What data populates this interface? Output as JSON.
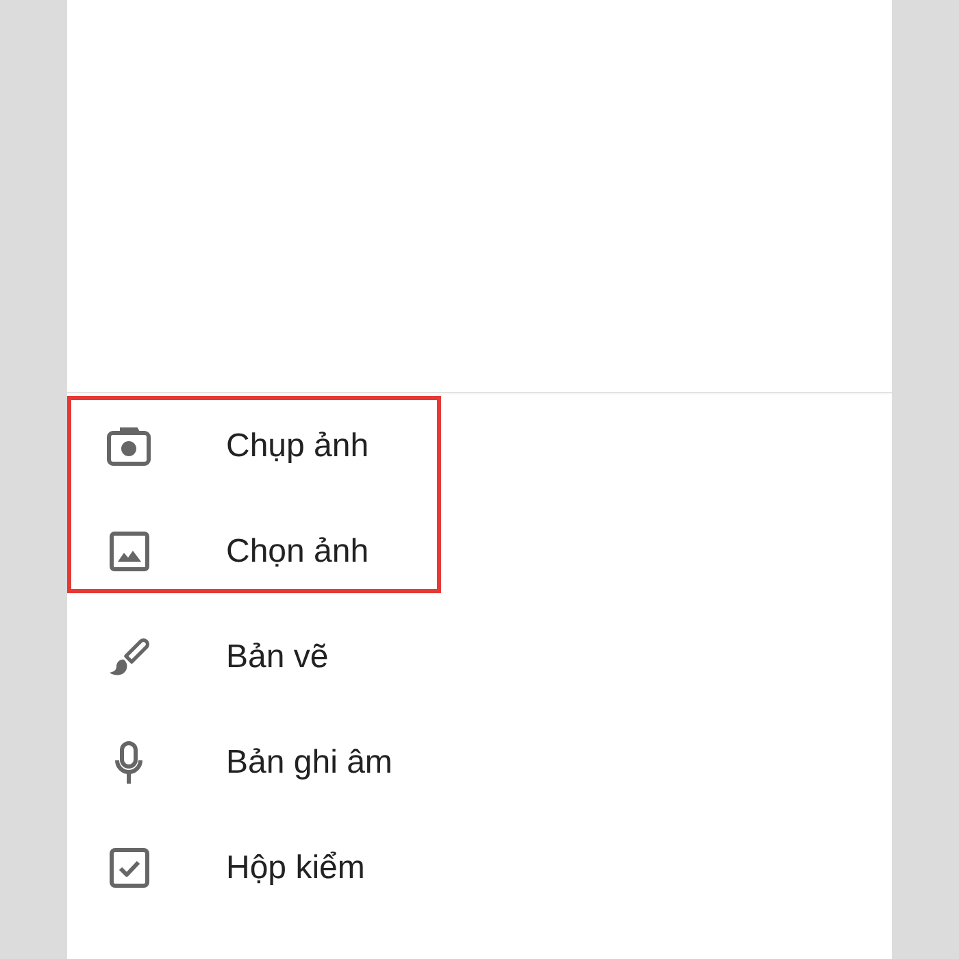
{
  "menu": {
    "items": [
      {
        "kind": "photo",
        "label": "Chụp ảnh",
        "highlighted": true
      },
      {
        "kind": "gallery",
        "label": "Chọn ảnh",
        "highlighted": true
      },
      {
        "kind": "drawing",
        "label": "Bản vẽ",
        "highlighted": false
      },
      {
        "kind": "recording",
        "label": "Bản ghi âm",
        "highlighted": false
      },
      {
        "kind": "checkboxes",
        "label": "Hộp kiểm",
        "highlighted": false
      }
    ]
  }
}
